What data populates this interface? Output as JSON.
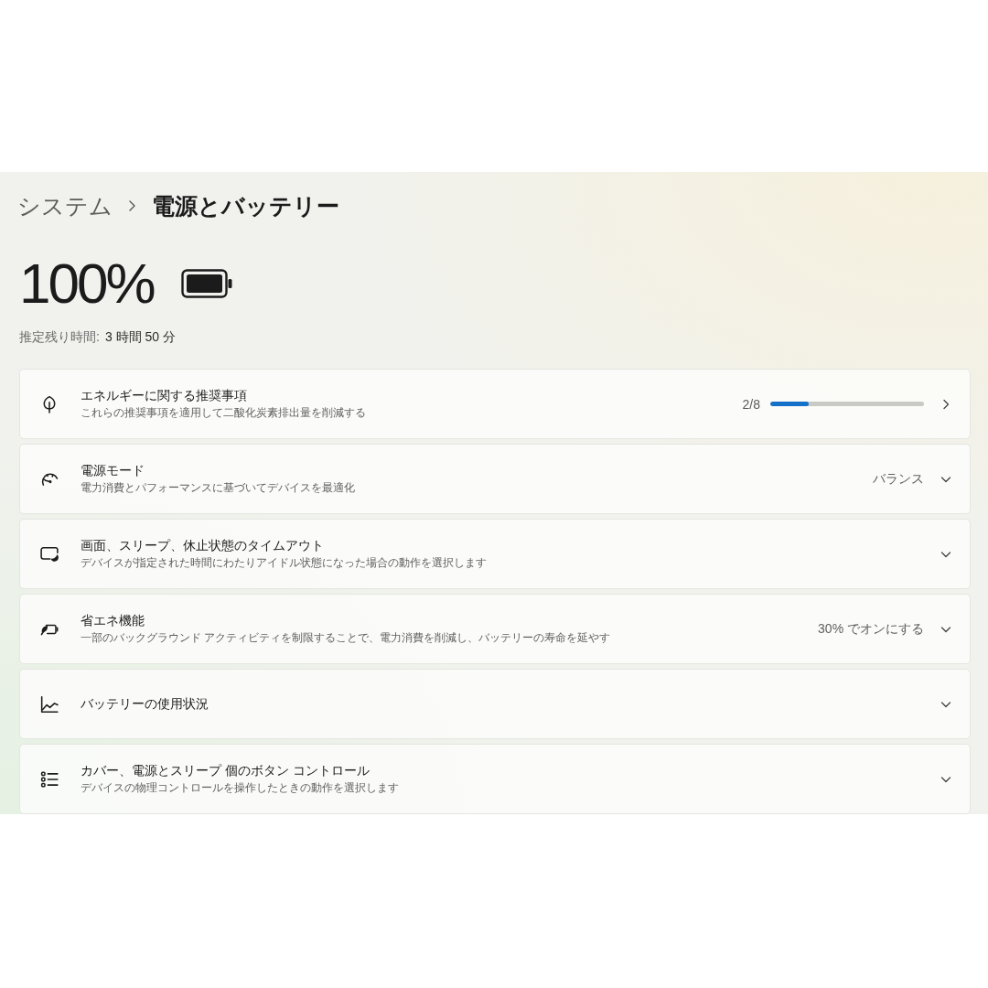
{
  "breadcrumb": {
    "parent": "システム",
    "current": "電源とバッテリー"
  },
  "battery": {
    "percent": "100%"
  },
  "estimate": {
    "label": "推定残り時間:",
    "value": "3 時間 50 分"
  },
  "settings": [
    {
      "kind": "link",
      "title": "エネルギーに関する推奨事項",
      "subtitle": "これらの推奨事項を適用して二酸化炭素排出量を削減する",
      "progress": {
        "count": "2/8",
        "level": 0.25
      }
    },
    {
      "kind": "expander",
      "title": "電源モード",
      "subtitle": "電力消費とパフォーマンスに基づいてデバイスを最適化",
      "value": "バランス"
    },
    {
      "kind": "expander",
      "title": "画面、スリープ、休止状態のタイムアウト",
      "subtitle": "デバイスが指定された時間にわたりアイドル状態になった場合の動作を選択します"
    },
    {
      "kind": "expander",
      "title": "省エネ機能",
      "subtitle": "一部のバックグラウンド アクティビティを制限することで、電力消費を削減し、バッテリーの寿命を延やす",
      "value": "30% でオンにする"
    },
    {
      "kind": "expander",
      "title": "バッテリーの使用状況"
    },
    {
      "kind": "expander",
      "title": "カバー、電源とスリープ 個のボタン コントロール",
      "subtitle": "デバイスの物理コントロールを操作したときの動作を選択します"
    }
  ]
}
